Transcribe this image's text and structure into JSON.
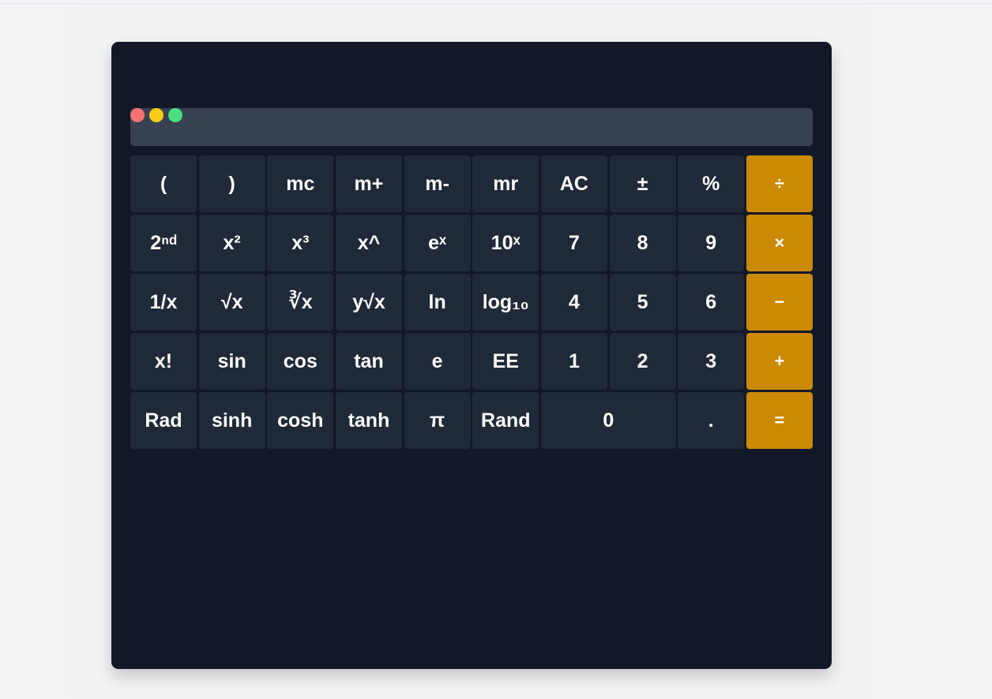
{
  "window_controls": [
    "close",
    "minimize",
    "maximize"
  ],
  "colors": {
    "page_bg": "#f3f4f6",
    "calculator_bg": "#121827",
    "display_bg": "#374151",
    "key_bg": "#1f2937",
    "operator_bg": "#ca8a04",
    "close_dot": "#f87171",
    "minimize_dot": "#facc15",
    "maximize_dot": "#4ade80"
  },
  "display": {
    "value": ""
  },
  "keys": [
    {
      "label": "(",
      "kind": "fn"
    },
    {
      "label": ")",
      "kind": "fn"
    },
    {
      "label": "mc",
      "kind": "fn"
    },
    {
      "label": "m+",
      "kind": "fn"
    },
    {
      "label": "m-",
      "kind": "fn"
    },
    {
      "label": "mr",
      "kind": "fn"
    },
    {
      "label": "AC",
      "kind": "fn"
    },
    {
      "label": "±",
      "kind": "fn"
    },
    {
      "label": "%",
      "kind": "fn"
    },
    {
      "label": "÷",
      "kind": "op"
    },
    {
      "label": "2ⁿᵈ",
      "kind": "fn"
    },
    {
      "label": "x²",
      "kind": "fn"
    },
    {
      "label": "x³",
      "kind": "fn"
    },
    {
      "label": "x^",
      "kind": "fn"
    },
    {
      "label": "eˣ",
      "kind": "fn"
    },
    {
      "label": "10ˣ",
      "kind": "fn"
    },
    {
      "label": "7",
      "kind": "num"
    },
    {
      "label": "8",
      "kind": "num"
    },
    {
      "label": "9",
      "kind": "num"
    },
    {
      "label": "×",
      "kind": "op"
    },
    {
      "label": "1/x",
      "kind": "fn"
    },
    {
      "label": "√x",
      "kind": "fn"
    },
    {
      "label": "∛x",
      "kind": "fn"
    },
    {
      "label": "y√x",
      "kind": "fn"
    },
    {
      "label": "ln",
      "kind": "fn"
    },
    {
      "label": "log₁₀",
      "kind": "fn"
    },
    {
      "label": "4",
      "kind": "num"
    },
    {
      "label": "5",
      "kind": "num"
    },
    {
      "label": "6",
      "kind": "num"
    },
    {
      "label": "−",
      "kind": "op"
    },
    {
      "label": "x!",
      "kind": "fn"
    },
    {
      "label": "sin",
      "kind": "fn"
    },
    {
      "label": "cos",
      "kind": "fn"
    },
    {
      "label": "tan",
      "kind": "fn"
    },
    {
      "label": "e",
      "kind": "fn"
    },
    {
      "label": "EE",
      "kind": "fn"
    },
    {
      "label": "1",
      "kind": "num"
    },
    {
      "label": "2",
      "kind": "num"
    },
    {
      "label": "3",
      "kind": "num"
    },
    {
      "label": "+",
      "kind": "op"
    },
    {
      "label": "Rad",
      "kind": "fn"
    },
    {
      "label": "sinh",
      "kind": "fn"
    },
    {
      "label": "cosh",
      "kind": "fn"
    },
    {
      "label": "tanh",
      "kind": "fn"
    },
    {
      "label": "π",
      "kind": "fn"
    },
    {
      "label": "Rand",
      "kind": "fn"
    },
    {
      "label": "0",
      "kind": "num"
    },
    {
      "label": ".",
      "kind": "num"
    },
    {
      "label": "=",
      "kind": "op"
    }
  ]
}
